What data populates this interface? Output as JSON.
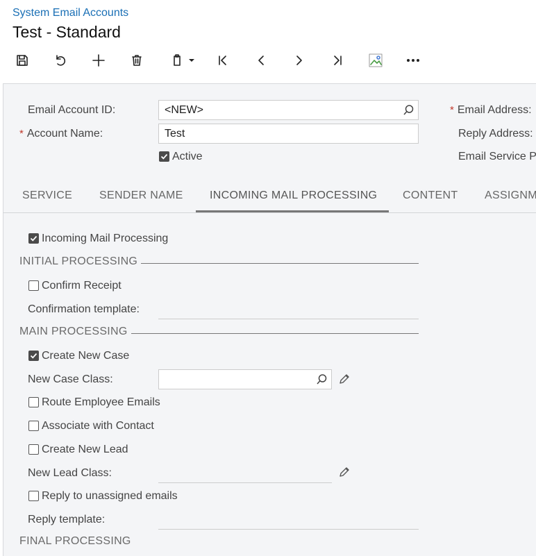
{
  "breadcrumb": "System Email Accounts",
  "title": "Test - Standard",
  "toolbar": {
    "icons": [
      "save-icon",
      "undo-icon",
      "add-icon",
      "delete-icon",
      "copy-paste-icon",
      "first-record-icon",
      "previous-record-icon",
      "next-record-icon",
      "last-record-icon",
      "image-icon",
      "more-icon"
    ]
  },
  "form": {
    "email_account_id_label": "Email Account ID:",
    "email_account_id_value": "<NEW>",
    "account_name_label": "Account Name:",
    "account_name_value": "Test",
    "active_label": "Active",
    "active_checked": true,
    "email_address_label": "Email Address:",
    "reply_address_label": "Reply Address:",
    "email_service_label": "Email Service P",
    "required_mark": "*"
  },
  "tabs": [
    {
      "label": "SERVICE",
      "active": false
    },
    {
      "label": "SENDER NAME",
      "active": false
    },
    {
      "label": "INCOMING MAIL PROCESSING",
      "active": true
    },
    {
      "label": "CONTENT",
      "active": false
    },
    {
      "label": "ASSIGNM",
      "active": false
    }
  ],
  "processing": {
    "incoming_mail_processing": {
      "label": "Incoming Mail Processing",
      "checked": true
    },
    "initial_processing_header": "INITIAL PROCESSING",
    "confirm_receipt": {
      "label": "Confirm Receipt",
      "checked": false
    },
    "confirmation_template_label": "Confirmation template:",
    "main_processing_header": "MAIN PROCESSING",
    "create_new_case": {
      "label": "Create New Case",
      "checked": true
    },
    "new_case_class_label": "New Case Class:",
    "route_employee_emails": {
      "label": "Route Employee Emails",
      "checked": false
    },
    "associate_with_contact": {
      "label": "Associate with Contact",
      "checked": false
    },
    "create_new_lead": {
      "label": "Create New Lead",
      "checked": false
    },
    "new_lead_class_label": "New Lead Class:",
    "reply_to_unassigned": {
      "label": "Reply to unassigned emails",
      "checked": false
    },
    "reply_template_label": "Reply template:",
    "final_processing_header": "FINAL PROCESSING"
  },
  "colors": {
    "accent": "#1a6fb5",
    "panel": "#f4f5f7",
    "required": "#c0392b"
  }
}
